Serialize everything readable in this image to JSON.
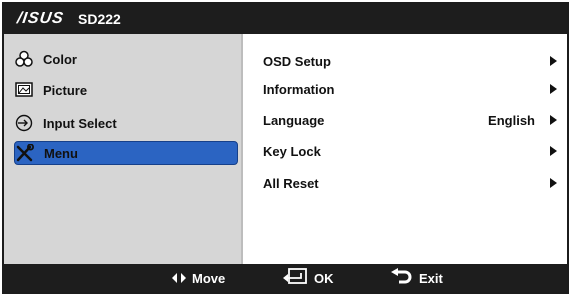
{
  "title_bar": {
    "brand": "/ISUS",
    "model": "SD222"
  },
  "sidebar": {
    "items": [
      {
        "label": "Color",
        "icon": "color-icon",
        "selected": false
      },
      {
        "label": "Picture",
        "icon": "picture-icon",
        "selected": false
      },
      {
        "label": "Input Select",
        "icon": "input-select-icon",
        "selected": false
      },
      {
        "label": "Menu",
        "icon": "wrench-screwdriver-icon",
        "selected": true
      }
    ]
  },
  "content": {
    "rows": [
      {
        "label": "OSD Setup",
        "value": ""
      },
      {
        "label": "Information",
        "value": ""
      },
      {
        "label": "Language",
        "value": "English"
      },
      {
        "label": "Key Lock",
        "value": ""
      },
      {
        "label": "All Reset",
        "value": ""
      }
    ]
  },
  "footer": {
    "move_label": "Move",
    "ok_label": "OK",
    "exit_label": "Exit"
  },
  "colors": {
    "bar_background": "#1d1d1d",
    "sidebar_background": "#d6d6d6",
    "selection_blue": "#2b64c2"
  }
}
